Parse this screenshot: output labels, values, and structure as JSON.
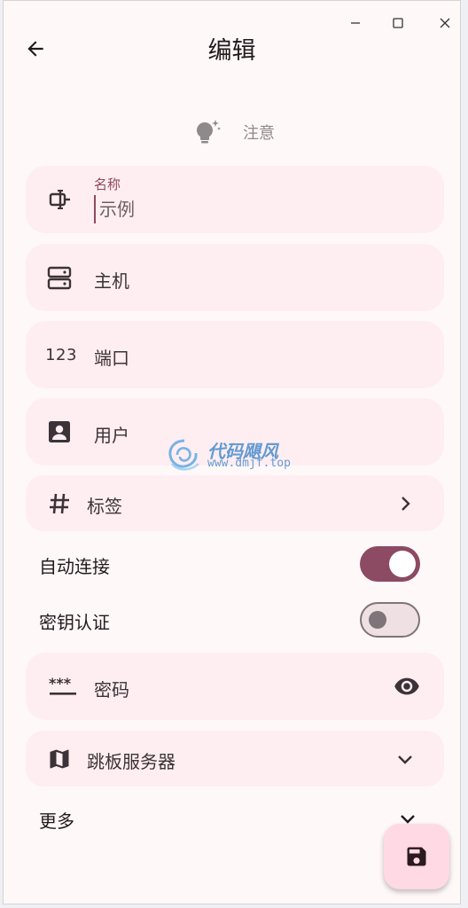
{
  "header": {
    "title": "编辑",
    "notice": "注意"
  },
  "fields": {
    "name": {
      "label": "名称",
      "placeholder": "示例",
      "value": ""
    },
    "host": {
      "label": "主机"
    },
    "port": {
      "icon_text": "123",
      "label": "端口"
    },
    "user": {
      "label": "用户"
    },
    "tags": {
      "label": "标签"
    },
    "password": {
      "icon_text": "***",
      "label": "密码"
    },
    "jump_server": {
      "label": "跳板服务器"
    }
  },
  "switches": {
    "auto_connect": {
      "label": "自动连接",
      "on": true
    },
    "key_auth": {
      "label": "密钥认证",
      "on": false
    }
  },
  "more": {
    "label": "更多"
  },
  "watermark": {
    "main": "代码飓风",
    "sub": "www.dmjf.top"
  },
  "colors": {
    "primary": "#8c4a63",
    "card_bg": "#ffeef1",
    "page_bg": "#fff8f9",
    "fab_bg": "#ffd9e3"
  },
  "icons": {
    "back": "arrow-back-icon",
    "notice": "lightbulb-icon",
    "name": "label-icon",
    "host": "dns-icon",
    "user": "account-box-icon",
    "tags": "tag-icon",
    "tags_trailing": "chevron-right-icon",
    "password_trailing": "visibility-icon",
    "jump_server": "map-icon",
    "jump_server_trailing": "chevron-down-icon",
    "save": "save-icon"
  }
}
